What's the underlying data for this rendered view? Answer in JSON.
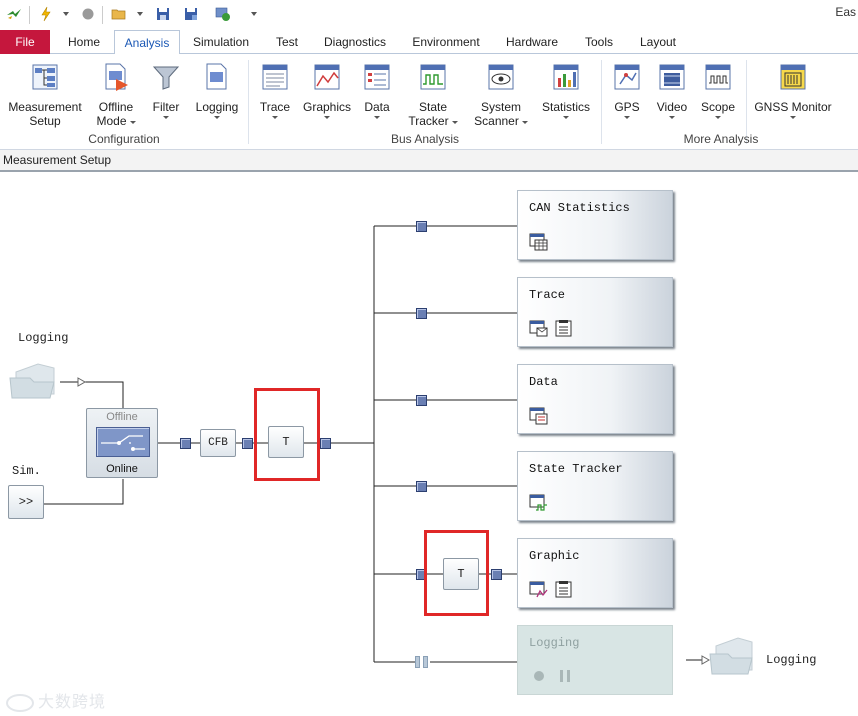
{
  "app_title": "Eas",
  "tabs": [
    {
      "label": "File"
    },
    {
      "label": "Home"
    },
    {
      "label": "Analysis"
    },
    {
      "label": "Simulation"
    },
    {
      "label": "Test"
    },
    {
      "label": "Diagnostics"
    },
    {
      "label": "Environment"
    },
    {
      "label": "Hardware"
    },
    {
      "label": "Tools"
    },
    {
      "label": "Layout"
    }
  ],
  "ribbon": {
    "groups": [
      {
        "label": "Configuration"
      },
      {
        "label": "Bus Analysis"
      },
      {
        "label": "More Analysis"
      }
    ],
    "buttons": [
      {
        "line1": "Measurement",
        "line2": "Setup"
      },
      {
        "line1": "Offline",
        "line2": "Mode"
      },
      {
        "line1": "Filter",
        "line2": ""
      },
      {
        "line1": "Logging",
        "line2": ""
      },
      {
        "line1": "Trace",
        "line2": ""
      },
      {
        "line1": "Graphics",
        "line2": ""
      },
      {
        "line1": "Data",
        "line2": ""
      },
      {
        "line1": "State",
        "line2": "Tracker"
      },
      {
        "line1": "System",
        "line2": "Scanner"
      },
      {
        "line1": "Statistics",
        "line2": ""
      },
      {
        "line1": "GPS",
        "line2": ""
      },
      {
        "line1": "Video",
        "line2": ""
      },
      {
        "line1": "Scope",
        "line2": ""
      },
      {
        "line1": "GNSS Monitor",
        "line2": ""
      }
    ]
  },
  "panel": {
    "title": "Measurement Setup"
  },
  "diagram": {
    "logging_in_label": "Logging",
    "sim_label": "Sim.",
    "sim_button": ">>",
    "switch_offline": "Offline",
    "switch_online": "Online",
    "cfb_label": "CFB",
    "trigger_label": "T",
    "trigger2_label": "T",
    "analysis_blocks": [
      {
        "title": "CAN Statistics"
      },
      {
        "title": "Trace"
      },
      {
        "title": "Data"
      },
      {
        "title": "State Tracker"
      },
      {
        "title": "Graphic"
      },
      {
        "title": "Logging"
      }
    ],
    "logging_out_label": "Logging",
    "highlight_color": "#e02727"
  },
  "watermark": "大数跨境"
}
